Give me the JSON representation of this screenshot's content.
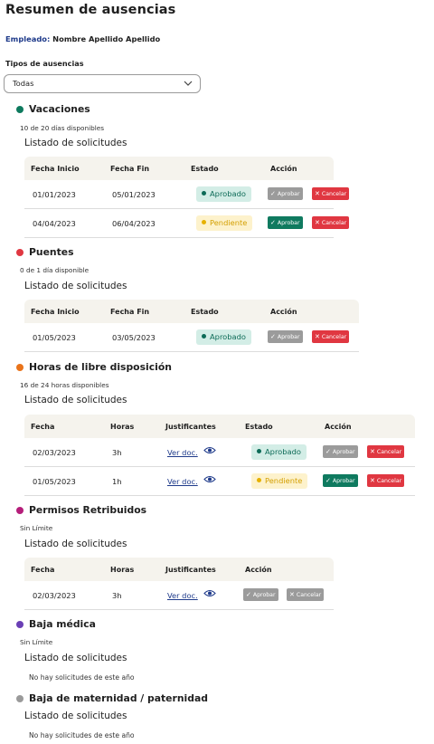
{
  "page": {
    "title": "Resumen de ausencias"
  },
  "employee": {
    "label": "Empleado:",
    "name": "Nombre Apellido Apellido"
  },
  "filter": {
    "label": "Tipos de ausencias",
    "value": "Todas"
  },
  "common": {
    "listado": "Listado de solicitudes",
    "empty": "No hay solicitudes de este año",
    "approve": "Aprobar",
    "cancel": "Cancelar",
    "ver_doc": "Ver doc."
  },
  "colors": {
    "vacaciones": "#0e7a5e",
    "puentes": "#e03741",
    "horas": "#e9731a",
    "permisos": "#b51e7a",
    "baja_medica": "#6a3fb5",
    "baja_maternidad": "#9a9a9a"
  },
  "vacaciones": {
    "title": "Vacaciones",
    "available": "10 de 20 días disponibles",
    "headers": [
      "Fecha Inicio",
      "Fecha Fin",
      "Estado",
      "Acción"
    ],
    "rows": [
      {
        "start": "01/01/2023",
        "end": "05/01/2023",
        "status": "Aprobado"
      },
      {
        "start": "04/04/2023",
        "end": "06/04/2023",
        "status": "Pendiente"
      }
    ]
  },
  "puentes": {
    "title": "Puentes",
    "available": "0 de 1 día disponible",
    "headers": [
      "Fecha Inicio",
      "Fecha Fin",
      "Estado",
      "Acción"
    ],
    "rows": [
      {
        "start": "01/05/2023",
        "end": "03/05/2023",
        "status": "Aprobado"
      }
    ]
  },
  "horas": {
    "title": "Horas de libre disposición",
    "available": "16 de 24 horas disponibles",
    "headers": [
      "Fecha",
      "Horas",
      "Justificantes",
      "Estado",
      "Acción"
    ],
    "rows": [
      {
        "date": "02/03/2023",
        "hours": "3h",
        "status": "Aprobado"
      },
      {
        "date": "01/05/2023",
        "hours": "1h",
        "status": "Pendiente"
      }
    ]
  },
  "permisos": {
    "title": "Permisos Retribuidos",
    "available": "Sin Límite",
    "headers": [
      "Fecha",
      "Horas",
      "Justificantes",
      "Acción"
    ],
    "rows": [
      {
        "date": "02/03/2023",
        "hours": "3h"
      }
    ]
  },
  "baja_medica": {
    "title": "Baja médica",
    "available": "Sin Límite"
  },
  "baja_maternidad": {
    "title": "Baja de maternidad / paternidad"
  }
}
